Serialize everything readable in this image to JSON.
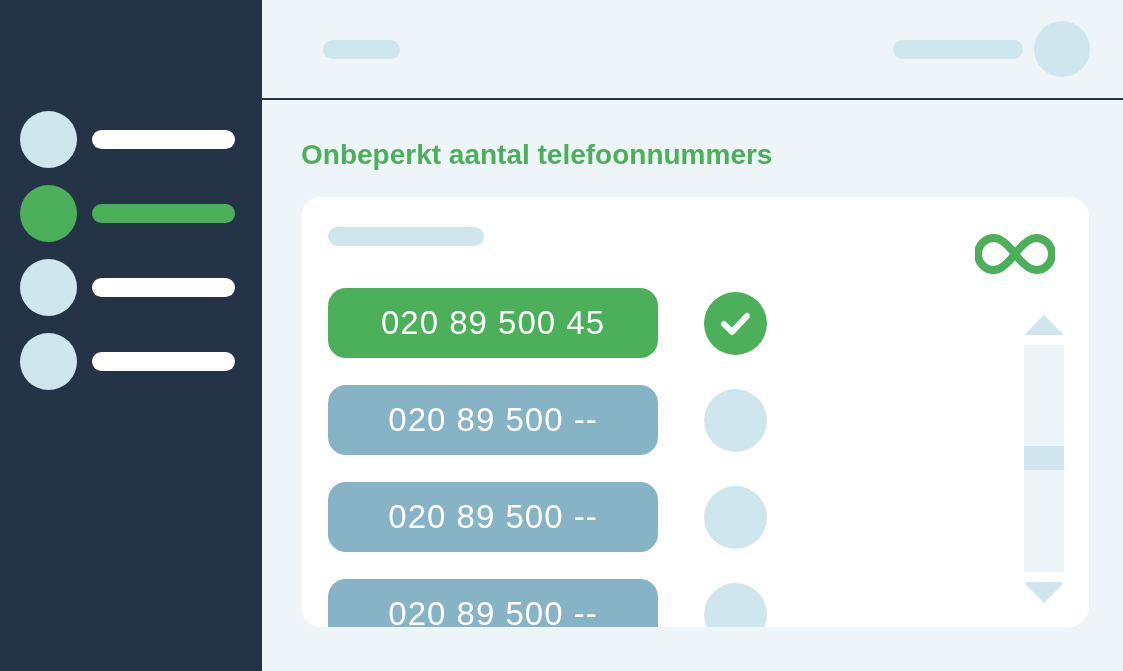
{
  "sidebar": {
    "items": [
      {
        "selected": false
      },
      {
        "selected": true
      },
      {
        "selected": false
      },
      {
        "selected": false
      }
    ]
  },
  "title": "Onbeperkt aantal telefoonnummers",
  "numbers": [
    {
      "label": "020 89 500 45",
      "selected": true
    },
    {
      "label": "020 89 500 --",
      "selected": false
    },
    {
      "label": "020 89 500 --",
      "selected": false
    },
    {
      "label": "020 89 500 --",
      "selected": false
    }
  ]
}
